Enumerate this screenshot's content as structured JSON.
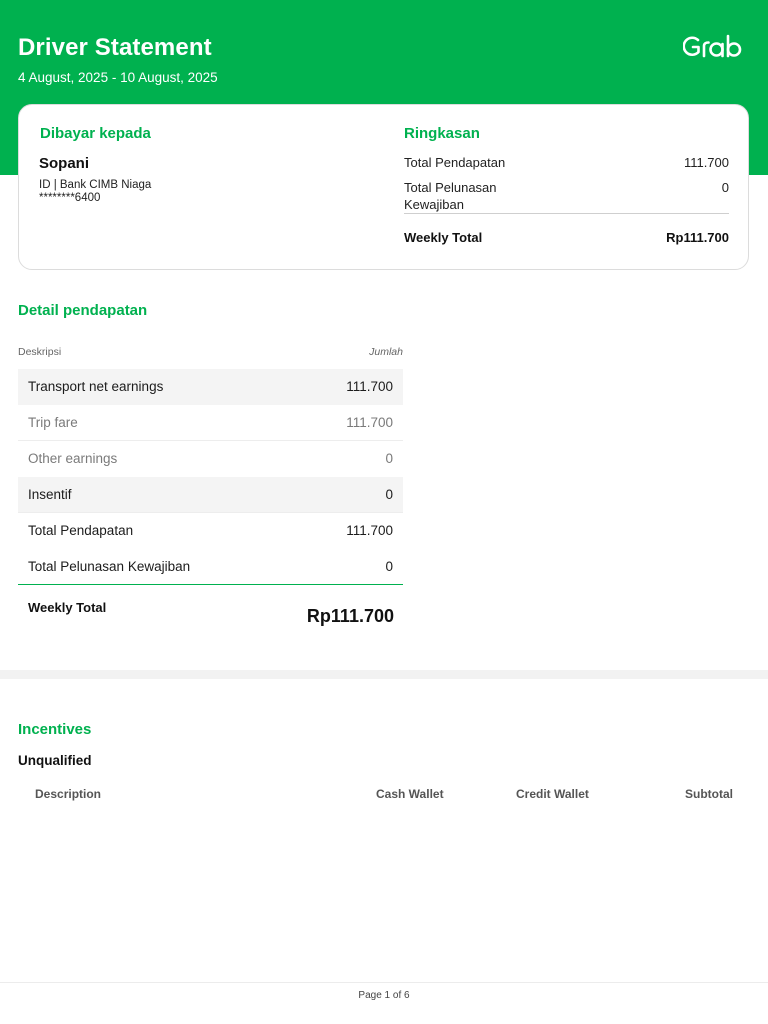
{
  "header": {
    "title": "Driver Statement",
    "period": "4 August, 2025 - 10 August, 2025",
    "brand_logo": "Grab",
    "brand_color": "#00b14f"
  },
  "payee": {
    "heading": "Dibayar kepada",
    "name": "Sopani",
    "bank_line": "ID | Bank CIMB Niaga",
    "account_masked": "********6400"
  },
  "summary": {
    "heading": "Ringkasan",
    "rows": [
      {
        "label": "Total Pendapatan",
        "value": "111.700"
      },
      {
        "label_line1": "Total Pelunasan",
        "label_line2": "Kewajiban",
        "value": "0"
      }
    ],
    "total_label": "Weekly Total",
    "total_value": "Rp111.700"
  },
  "earnings": {
    "heading": "Detail pendapatan",
    "col_description": "Deskripsi",
    "col_amount": "Jumlah",
    "rows": [
      {
        "label": "Transport net earnings",
        "value": "111.700"
      },
      {
        "label": "Trip fare",
        "value": "111.700"
      },
      {
        "label": "Other earnings",
        "value": "0"
      },
      {
        "label": "Insentif",
        "value": "0"
      },
      {
        "label": "Total Pendapatan",
        "value": "111.700"
      },
      {
        "label": "Total Pelunasan Kewajiban",
        "value": "0"
      }
    ],
    "total_label": "Weekly Total",
    "total_value": "Rp111.700"
  },
  "incentives": {
    "heading": "Incentives",
    "subheading": "Unqualified",
    "columns": [
      "Description",
      "Cash Wallet",
      "Credit Wallet",
      "Subtotal"
    ]
  },
  "footer": {
    "page": "Page 1 of 6"
  }
}
